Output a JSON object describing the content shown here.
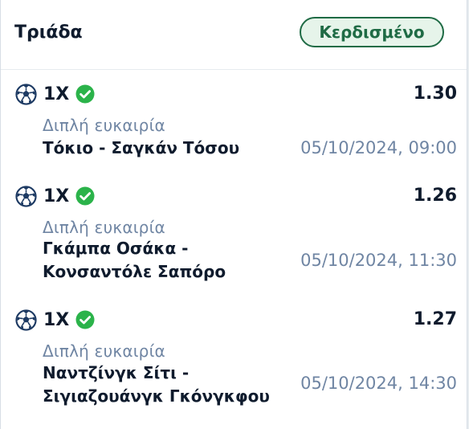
{
  "card": {
    "title": "Τριάδα",
    "status": "Κερδισμένο"
  },
  "selections": [
    {
      "pick": "1X",
      "odds": "1.30",
      "market": "Διπλή ευκαιρία",
      "event_line1": "Τόκιο - Σαγκάν Τόσου",
      "event_line2": "",
      "datetime": "05/10/2024, 09:00"
    },
    {
      "pick": "1X",
      "odds": "1.26",
      "market": "Διπλή ευκαιρία",
      "event_line1": "Γκάμπα Οσάκα -",
      "event_line2": "Κονσαντόλε Σαπόρο",
      "datetime": "05/10/2024, 11:30"
    },
    {
      "pick": "1X",
      "odds": "1.27",
      "market": "Διπλή ευκαιρία",
      "event_line1": "Ναντζίνγκ Σίτι -",
      "event_line2": "Σιγιαζουάνγκ Γκόνγκφου",
      "datetime": "05/10/2024, 14:30"
    }
  ],
  "colors": {
    "won_green": "#1f6b45",
    "check_green": "#2bb34a",
    "muted_text": "#6f85a3",
    "ball_blue": "#1d3a63"
  },
  "icons": {
    "sport": "soccer-ball-icon",
    "result": "check-circle-icon"
  }
}
